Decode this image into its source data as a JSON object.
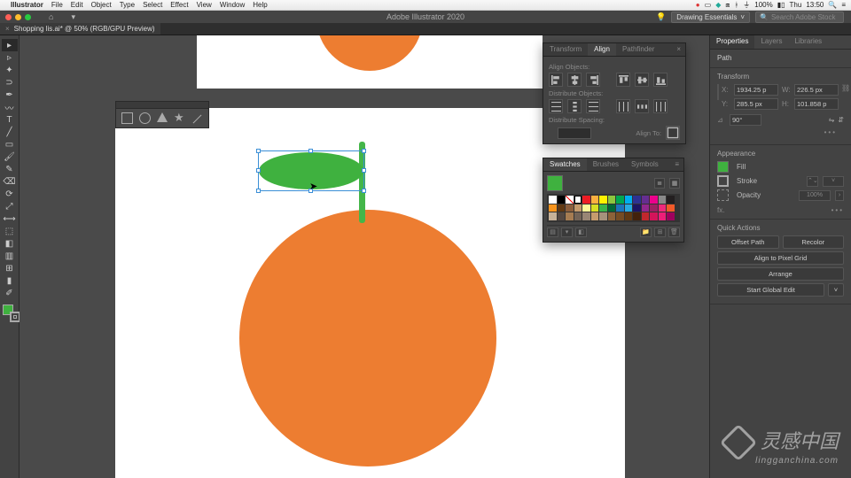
{
  "mac_menu": {
    "app": "Illustrator",
    "items": [
      "File",
      "Edit",
      "Object",
      "Type",
      "Select",
      "Effect",
      "View",
      "Window",
      "Help"
    ],
    "status_battery": "100%",
    "status_day": "Thu",
    "status_time": "13:50"
  },
  "window": {
    "title": "Adobe Illustrator 2020",
    "workspace": "Drawing Essentials",
    "search_placeholder": "Search Adobe Stock"
  },
  "tab": {
    "label": "Shopping lis.ai* @ 50% (RGB/GPU Preview)"
  },
  "properties": {
    "tabs": [
      "Properties",
      "Layers",
      "Libraries"
    ],
    "active_tab": 0,
    "selection_type": "Path",
    "transform": {
      "title": "Transform",
      "x": "1934.25 p",
      "y": "285.5 px",
      "w": "226.5 px",
      "h": "101.858 p",
      "rotate": "90°",
      "shear_label": "⟂"
    },
    "appearance": {
      "title": "Appearance",
      "fill_label": "Fill",
      "stroke_label": "Stroke",
      "stroke_weight": "",
      "opacity_label": "Opacity",
      "opacity_value": "100%",
      "fx_label": "fx."
    },
    "quick": {
      "title": "Quick Actions",
      "offset": "Offset Path",
      "recolor": "Recolor",
      "pixelgrid": "Align to Pixel Grid",
      "arrange": "Arrange",
      "globaledit": "Start Global Edit"
    }
  },
  "align_panel": {
    "tabs": [
      "Transform",
      "Align",
      "Pathfinder"
    ],
    "active": 1,
    "align_objects": "Align Objects:",
    "distribute_objects": "Distribute Objects:",
    "distribute_spacing": "Distribute Spacing:",
    "align_to": "Align To:"
  },
  "swatches_panel": {
    "tabs": [
      "Swatches",
      "Brushes",
      "Symbols"
    ],
    "active": 0,
    "colors": [
      "#fff",
      "#000",
      "none",
      "reg",
      "#ed1c24",
      "#fbb040",
      "#fff200",
      "#8dc63f",
      "#00a651",
      "#00aeef",
      "#2e3192",
      "#662d91",
      "#ec008c",
      "#898989",
      "#231f20",
      "#f7941d",
      "#603913",
      "#8b5e3c",
      "#c49a6c",
      "#fff799",
      "#d7df23",
      "#39b54a",
      "#006838",
      "#1b75bc",
      "#27aae1",
      "#1c1464",
      "#92278f",
      "#9e1f63",
      "#ee2a7b",
      "#f15a29",
      "#c7b299",
      "#534741",
      "#a67c52",
      "#736357",
      "#998675",
      "#c69c6d",
      "#a6927c",
      "#8c6239",
      "#754c24",
      "#603913",
      "#42210b",
      "#c1272d",
      "#d4145a",
      "#ed1e79",
      "#9e005d"
    ]
  },
  "tools": [
    {
      "name": "selection-tool",
      "glyph": "▸",
      "active": true
    },
    {
      "name": "direct-selection-tool",
      "glyph": "▹"
    },
    {
      "name": "magic-wand-tool",
      "glyph": "✦"
    },
    {
      "name": "lasso-tool",
      "glyph": "⊃"
    },
    {
      "name": "pen-tool",
      "glyph": "✒"
    },
    {
      "name": "curvature-tool",
      "glyph": "〰"
    },
    {
      "name": "type-tool",
      "glyph": "T"
    },
    {
      "name": "line-tool",
      "glyph": "╱"
    },
    {
      "name": "rectangle-tool",
      "glyph": "▭"
    },
    {
      "name": "paintbrush-tool",
      "glyph": "🖌"
    },
    {
      "name": "shaper-tool",
      "glyph": "✎"
    },
    {
      "name": "eraser-tool",
      "glyph": "⌫"
    },
    {
      "name": "rotate-tool",
      "glyph": "⟳"
    },
    {
      "name": "scale-tool",
      "glyph": "⤢"
    },
    {
      "name": "width-tool",
      "glyph": "⟷"
    },
    {
      "name": "free-transform-tool",
      "glyph": "⬚"
    },
    {
      "name": "shape-builder-tool",
      "glyph": "◧"
    },
    {
      "name": "perspective-tool",
      "glyph": "▥"
    },
    {
      "name": "mesh-tool",
      "glyph": "⊞"
    },
    {
      "name": "gradient-tool",
      "glyph": "▮"
    },
    {
      "name": "eyedropper-tool",
      "glyph": "✐"
    }
  ],
  "watermark": {
    "main": "灵感中国",
    "sub": "lingganchina.com"
  }
}
